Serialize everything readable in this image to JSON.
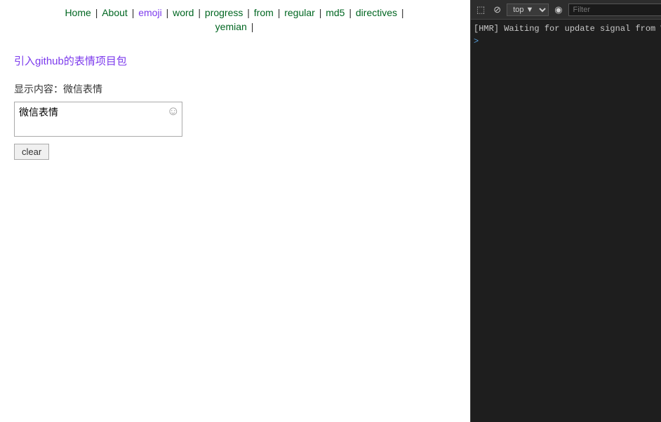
{
  "nav": {
    "items": [
      {
        "label": "Home",
        "href": "#",
        "class": "green"
      },
      {
        "label": "About",
        "href": "#",
        "class": "green"
      },
      {
        "label": "emoji",
        "href": "#",
        "class": "purple"
      },
      {
        "label": "word",
        "href": "#",
        "class": "green"
      },
      {
        "label": "progress",
        "href": "#",
        "class": "green"
      },
      {
        "label": "from",
        "href": "#",
        "class": "green"
      },
      {
        "label": "regular",
        "href": "#",
        "class": "green"
      },
      {
        "label": "md5",
        "href": "#",
        "class": "green"
      },
      {
        "label": "directives",
        "href": "#",
        "class": "green"
      },
      {
        "label": "yemian",
        "href": "#",
        "class": "green"
      }
    ],
    "separator": "|"
  },
  "content": {
    "github_link": "引入github的表情项目包",
    "display_label": "显示内容：微信表情",
    "textarea_value": "微信表情",
    "clear_button": "clear",
    "emoji_icon": "☺"
  },
  "devtools": {
    "toolbar": {
      "inspect_icon": "⬚",
      "cursor_icon": "⊘",
      "top_label": "top ▼",
      "eye_icon": "◉",
      "filter_placeholder": "Filter"
    },
    "console_lines": [
      "[HMR] Waiting for update signal from W"
    ],
    "caret": ">"
  }
}
